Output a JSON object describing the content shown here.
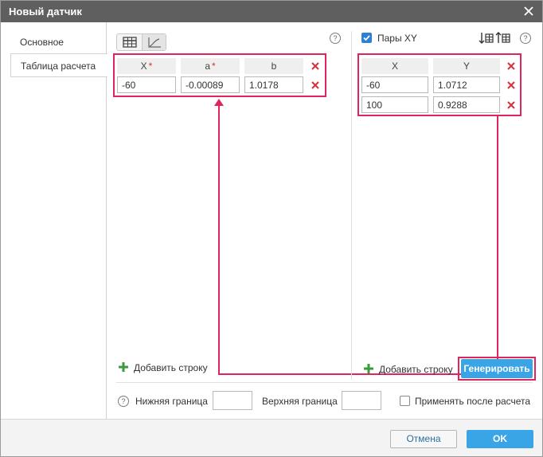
{
  "dialog": {
    "title": "Новый датчик"
  },
  "sidebar": {
    "items": [
      {
        "label": "Основное"
      },
      {
        "label": "Таблица расчета"
      }
    ]
  },
  "calc_table": {
    "help": "?",
    "headers": {
      "x": "X",
      "a": "a",
      "b": "b",
      "required_mark": "*"
    },
    "rows": [
      {
        "x": "-60",
        "a": "-0.00089",
        "b": "1.0178"
      }
    ],
    "add_row_label": "Добавить строку"
  },
  "xy_pairs": {
    "checkbox_label": "Пары XY",
    "checked": true,
    "help": "?",
    "headers": {
      "x": "X",
      "y": "Y"
    },
    "rows": [
      {
        "x": "-60",
        "y": "1.0712"
      },
      {
        "x": "100",
        "y": "0.9288"
      }
    ],
    "add_row_label": "Добавить строку",
    "generate_label": "Генерировать"
  },
  "bounds": {
    "help": "?",
    "lower_label": "Нижняя граница",
    "lower_value": "",
    "upper_label": "Верхняя граница",
    "upper_value": "",
    "apply_after_label": "Применять после расчета",
    "apply_after_checked": false
  },
  "footer": {
    "cancel_label": "Отмена",
    "ok_label": "OK"
  },
  "colors": {
    "accent": "#3aa5e6",
    "highlight": "#e0245e",
    "delete": "#d9303b",
    "add": "#3a9b3a"
  }
}
